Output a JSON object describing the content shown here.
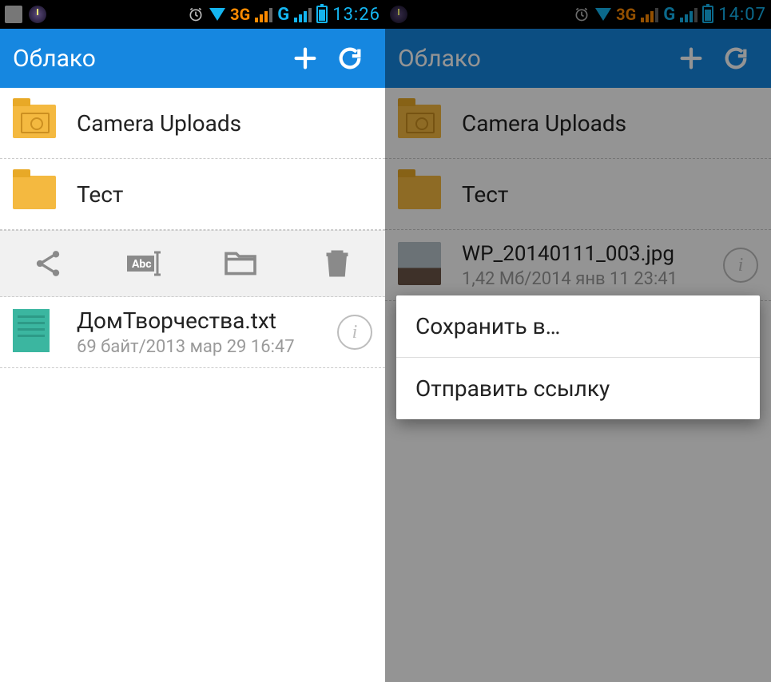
{
  "left": {
    "status": {
      "time": "13:26",
      "net1": "3G",
      "net2": "G"
    },
    "appbar": {
      "title": "Облако"
    },
    "items": [
      {
        "name": "Camera Uploads"
      },
      {
        "name": "Тест"
      }
    ],
    "file": {
      "name": "ДомТворчества.txt",
      "meta": "69 байт/2013 мар 29 16:47"
    }
  },
  "right": {
    "status": {
      "time": "14:07",
      "net1": "3G",
      "net2": "G"
    },
    "appbar": {
      "title": "Облако"
    },
    "items": [
      {
        "name": "Camera Uploads"
      },
      {
        "name": "Тест"
      }
    ],
    "file": {
      "name": "WP_20140111_003.jpg",
      "meta": "1,42 Мб/2014 янв 11 23:41"
    },
    "popup": {
      "save": "Сохранить в…",
      "send": "Отправить ссылку"
    }
  }
}
